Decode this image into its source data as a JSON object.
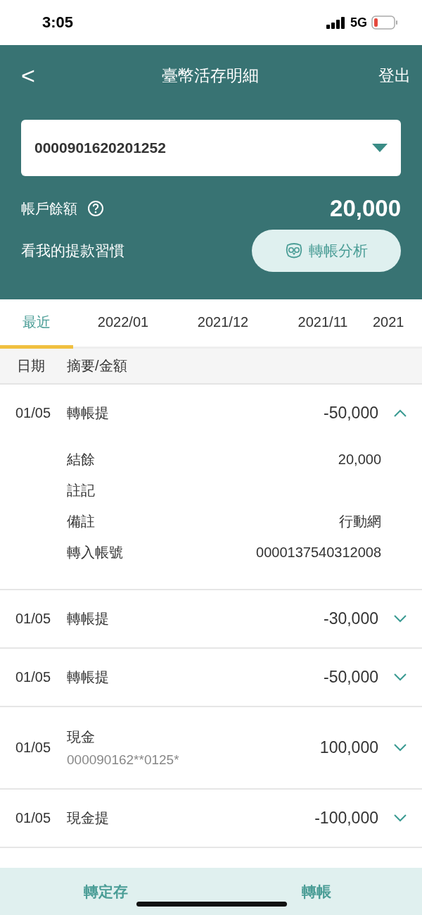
{
  "status_bar": {
    "time": "3:05",
    "network": "5G"
  },
  "header": {
    "back": "<",
    "title": "臺幣活存明細",
    "logout": "登出"
  },
  "account": {
    "number": "0000901620201252"
  },
  "balance": {
    "label": "帳戶餘額",
    "amount": "20,000"
  },
  "habit": {
    "label": "看我的提款習慣",
    "button": "轉帳分析"
  },
  "tabs": [
    {
      "label": "最近",
      "selected": true
    },
    {
      "label": "2022/01",
      "selected": false
    },
    {
      "label": "2021/12",
      "selected": false
    },
    {
      "label": "2021/11",
      "selected": false
    },
    {
      "label": "2021",
      "selected": false
    }
  ],
  "table": {
    "columns": [
      "日期",
      "摘要/金額"
    ],
    "rows": [
      {
        "date": "01/05",
        "summary": "轉帳提",
        "amount": "-50,000",
        "expanded": true,
        "details": [
          {
            "label": "結餘",
            "value": "20,000"
          },
          {
            "label": "註記"
          },
          {
            "label": "備註",
            "value": "行動網"
          },
          {
            "label": "轉入帳號",
            "value": "0000137540312008"
          }
        ]
      },
      {
        "date": "01/05",
        "summary": "轉帳提",
        "amount": "-30,000",
        "expanded": false
      },
      {
        "date": "01/05",
        "summary": "轉帳提",
        "amount": "-50,000",
        "expanded": false
      },
      {
        "date": "01/05",
        "summary": "現金",
        "sub": "000090162**0125*",
        "amount": "100,000",
        "expanded": false
      },
      {
        "date": "01/05",
        "summary": "現金提",
        "amount": "-100,000",
        "expanded": false
      }
    ]
  },
  "bottom_bar": [
    "轉定存",
    "轉帳"
  ]
}
